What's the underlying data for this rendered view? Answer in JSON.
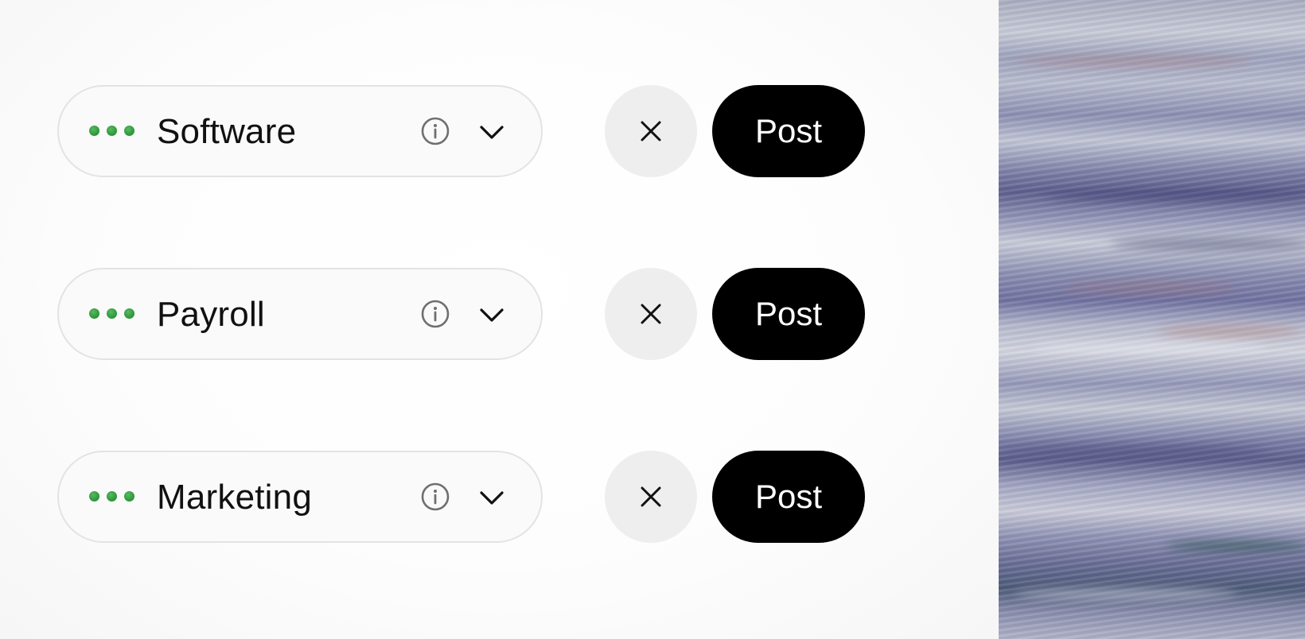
{
  "rows": [
    {
      "category": "Software",
      "post_label": "Post"
    },
    {
      "category": "Payroll",
      "post_label": "Post"
    },
    {
      "category": "Marketing",
      "post_label": "Post"
    }
  ],
  "icons": {
    "status": "status-dots-icon",
    "info": "info-icon",
    "dropdown": "chevron-down-icon",
    "clear": "close-icon"
  },
  "colors": {
    "status_dot": "#2f9a3c",
    "post_button_bg": "#000000",
    "post_button_text": "#ffffff",
    "clear_button_bg": "#eeeeee",
    "select_border": "#e3e3e3"
  }
}
